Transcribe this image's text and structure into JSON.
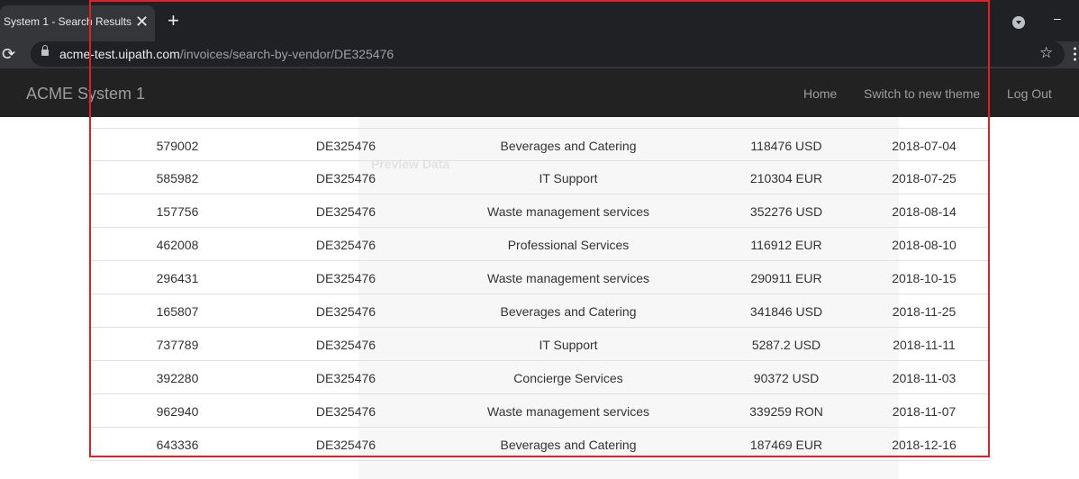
{
  "browser": {
    "tab_title": "System 1 - Search Results",
    "tab_close": "✕",
    "new_tab": "+",
    "reload_icon": "⟳",
    "url_host": "acme-test.uipath.com",
    "url_path": "/invoices/search-by-vendor/DE325476",
    "bookmark_icon": "☆",
    "minimize": "–"
  },
  "app": {
    "brand": "ACME System 1",
    "nav": [
      "Home",
      "Switch to new theme",
      "Log Out"
    ]
  },
  "background_panel": {
    "title": "Preview Data"
  },
  "invoices": [
    {
      "invoice": "579002",
      "vendor": "DE325476",
      "description": "Beverages and Catering",
      "total": "118476 USD",
      "date": "2018-07-04"
    },
    {
      "invoice": "585982",
      "vendor": "DE325476",
      "description": "IT Support",
      "total": "210304 EUR",
      "date": "2018-07-25"
    },
    {
      "invoice": "157756",
      "vendor": "DE325476",
      "description": "Waste management services",
      "total": "352276 USD",
      "date": "2018-08-14"
    },
    {
      "invoice": "462008",
      "vendor": "DE325476",
      "description": "Professional Services",
      "total": "116912 EUR",
      "date": "2018-08-10"
    },
    {
      "invoice": "296431",
      "vendor": "DE325476",
      "description": "Waste management services",
      "total": "290911 EUR",
      "date": "2018-10-15"
    },
    {
      "invoice": "165807",
      "vendor": "DE325476",
      "description": "Beverages and Catering",
      "total": "341846 USD",
      "date": "2018-11-25"
    },
    {
      "invoice": "737789",
      "vendor": "DE325476",
      "description": "IT Support",
      "total": "5287.2 USD",
      "date": "2018-11-11"
    },
    {
      "invoice": "392280",
      "vendor": "DE325476",
      "description": "Concierge Services",
      "total": "90372 USD",
      "date": "2018-11-03"
    },
    {
      "invoice": "962940",
      "vendor": "DE325476",
      "description": "Waste management services",
      "total": "339259 RON",
      "date": "2018-11-07"
    },
    {
      "invoice": "643336",
      "vendor": "DE325476",
      "description": "Beverages and Catering",
      "total": "187469 EUR",
      "date": "2018-12-16"
    }
  ],
  "colors": {
    "highlight": "#e31e24",
    "navbar": "#222222",
    "chrome": "#202124"
  }
}
